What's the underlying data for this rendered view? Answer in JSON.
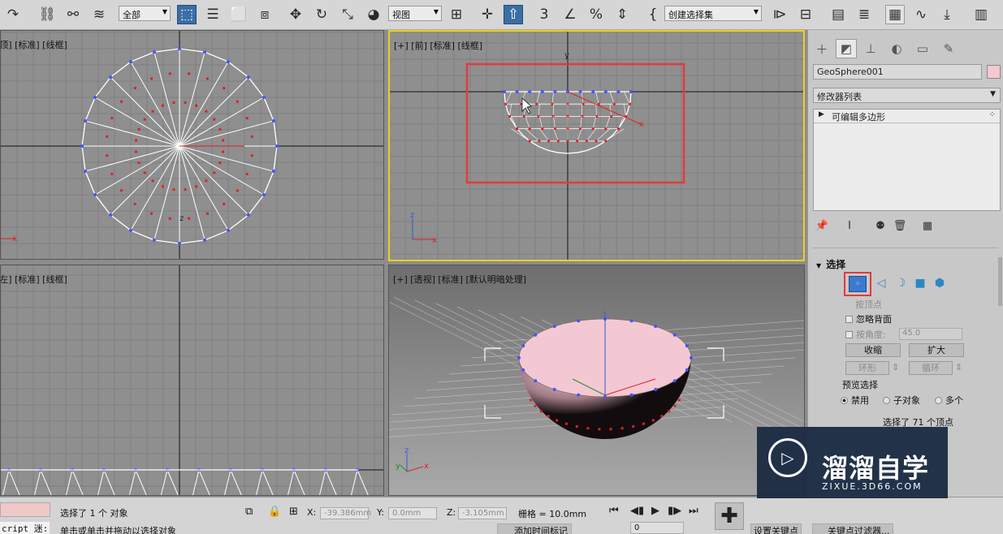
{
  "toolbar": {
    "selection_filter": "全部",
    "ref_coord": "视图",
    "named_selection": "创建选择集"
  },
  "viewports": {
    "top_label": "[顶] [标准] [线框]",
    "front_label": "[+] [前] [标准] [线框]",
    "left_label": "[左] [标准] [线框]",
    "persp_label": "[+] [透视] [标准] [默认明暗处理]",
    "axis_x": "x",
    "axis_y": "y",
    "axis_z": "z",
    "active_color": "#e8d21c",
    "highlight_color": "#e23b3b"
  },
  "command_panel": {
    "object_name": "GeoSphere001",
    "object_color": "#f4c8d2",
    "modifier_list": "修改器列表",
    "stack_item": "可编辑多边形",
    "rollout_title": "选择",
    "by_vertex": "按顶点",
    "ignore_backfacing": "忽略背面",
    "by_angle": "按角度:",
    "angle_value": "45.0",
    "shrink": "收缩",
    "grow": "扩大",
    "ring": "环形",
    "loop": "循环",
    "preview_selection": "预览选择",
    "preview_options": [
      "禁用",
      "子对象",
      "多个"
    ],
    "selected_count": "选择了 71 个顶点"
  },
  "status": {
    "script_label": "cript 迷:",
    "selection_text": "选择了 1 个 对象",
    "prompt_text": "单击或单击并拖动以选择对象",
    "x_label": "X:",
    "x_value": "-39.386mm",
    "y_label": "Y:",
    "y_value": "0.0mm",
    "z_label": "Z:",
    "z_value": "-3.105mm",
    "grid_text": "栅格 = 10.0mm",
    "add_time_tag": "添加时间标记",
    "frame_value": "0",
    "set_key": "设置关键点",
    "key_filters": "关键点过滤器..."
  },
  "watermark": {
    "brand_cn": "溜溜自学",
    "brand_url": "ZIXUE.3D66.COM"
  }
}
